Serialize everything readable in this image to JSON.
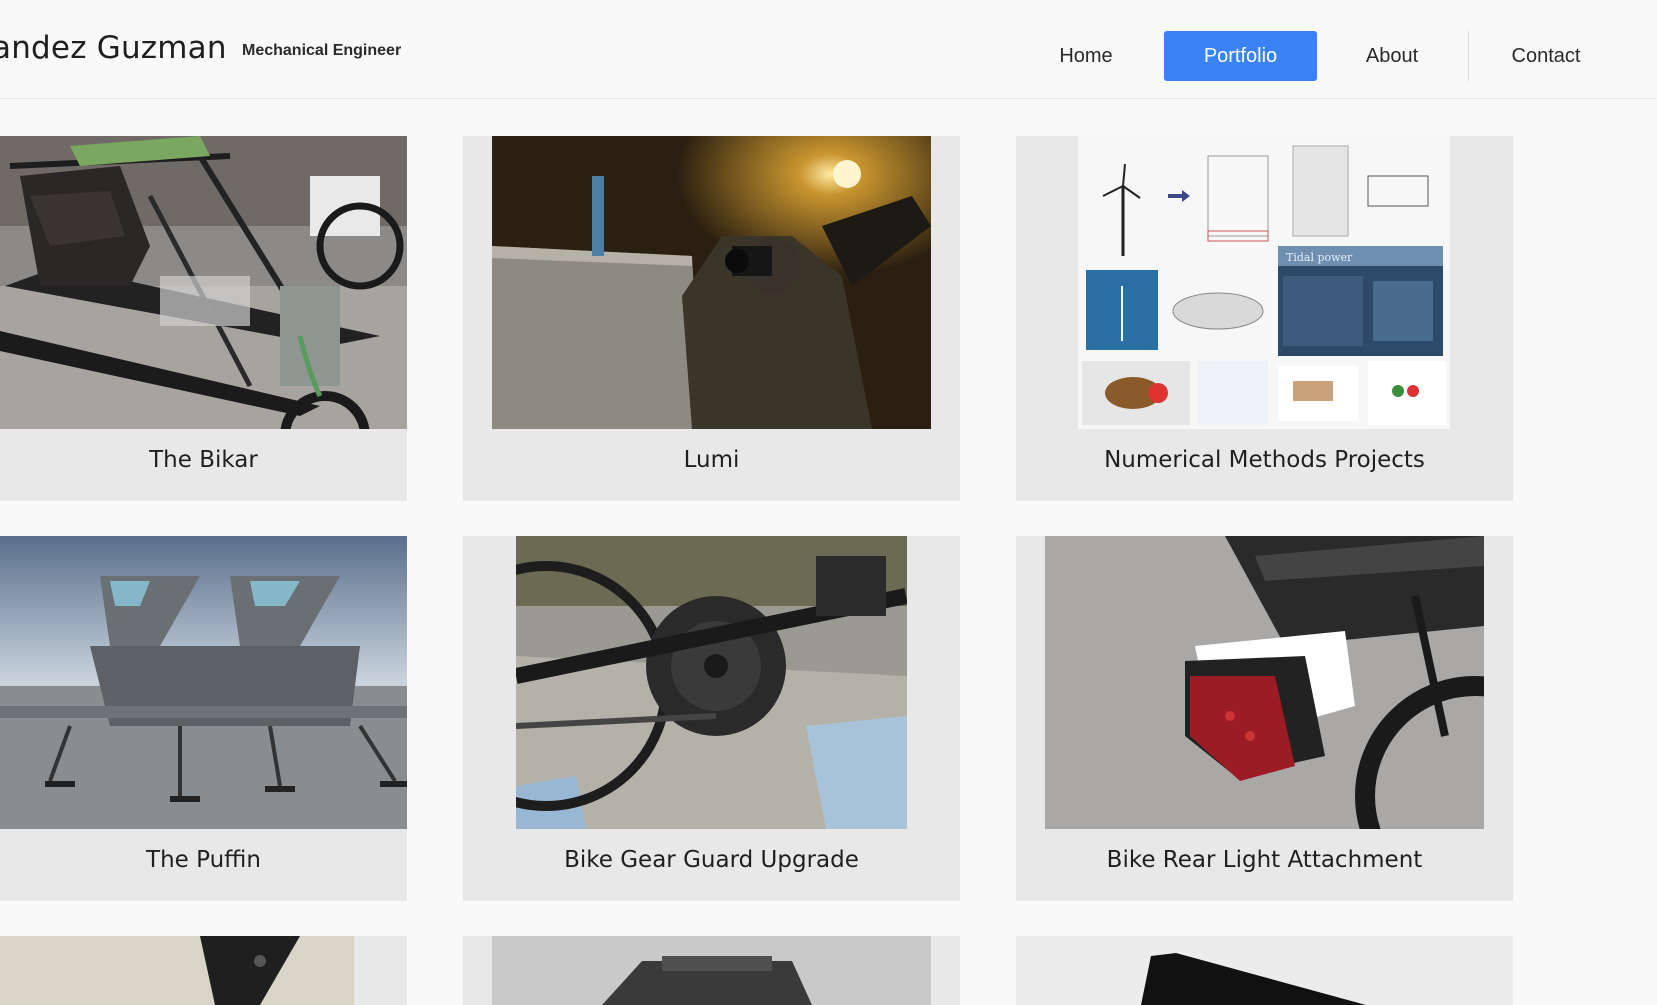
{
  "header": {
    "site_title": "andez Guzman",
    "site_subtitle": "Mechanical Engineer"
  },
  "nav": {
    "items": [
      {
        "label": "Home",
        "active": false
      },
      {
        "label": "Portfolio",
        "active": true
      },
      {
        "label": "About",
        "active": false
      },
      {
        "label": "Contact",
        "active": false
      }
    ],
    "active_color": "#3b82f6"
  },
  "portfolio": {
    "cards": [
      {
        "title": "The Bikar",
        "image_icon": "go-kart-frame-photo"
      },
      {
        "title": "Lumi",
        "image_icon": "photographer-night-photo"
      },
      {
        "title": "Numerical Methods Projects",
        "image_icon": "wind-tidal-power-collage"
      },
      {
        "title": "The Puffin",
        "image_icon": "aircraft-render"
      },
      {
        "title": "Bike Gear Guard Upgrade",
        "image_icon": "bike-chainring-guard-photo"
      },
      {
        "title": "Bike Rear Light Attachment",
        "image_icon": "bike-rear-light-photo"
      },
      {
        "title": "",
        "image_icon": "partial-photo"
      },
      {
        "title": "",
        "image_icon": "partial-photo"
      },
      {
        "title": "",
        "image_icon": "partial-photo"
      }
    ]
  },
  "collage_labels": {
    "tidal_power": "Tidal power"
  }
}
